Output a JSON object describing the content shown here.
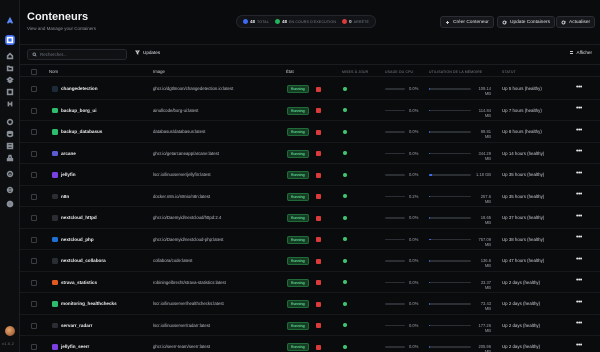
{
  "page": {
    "title": "Conteneurs",
    "subtitle": "View and Manage your Containers"
  },
  "sidebar": {
    "icons": [
      "arcane-logo-icon",
      "containers-icon",
      "home-icon",
      "folder-icon",
      "layers-icon",
      "image-icon",
      "network-icon",
      "volume-icon",
      "globe-icon",
      "database-icon",
      "server-icon",
      "drive-icon",
      "info-icon",
      "settings-icon",
      "user-icon"
    ],
    "version": "v1.0.2"
  },
  "stats": [
    {
      "num": "48",
      "label": "TOTAL",
      "color": "#3d6cf0"
    },
    {
      "num": "48",
      "label": "EN COURS D'EXECUTION",
      "color": "#22b45a"
    },
    {
      "num": "0",
      "label": "ARRÊTÉ",
      "color": "#d93a3a"
    }
  ],
  "actions": {
    "create": "Créer Conteneur",
    "update": "Update Containers",
    "refresh": "Actualiser"
  },
  "toolbar": {
    "search_placeholder": "Rechercher...",
    "filter": "Updates",
    "show": "Afficher"
  },
  "columns": {
    "name": "Nom",
    "image": "Image",
    "state": "État",
    "updates": "MISES À JOUR",
    "cpu": "USAGE DU CPU",
    "memory": "UTILISATION DE LA MÉMOIRE",
    "status": "STATUT"
  },
  "rows": [
    {
      "name": "changedetection",
      "image": "ghcr.io/dgtlmoon/changedetection.io:latest",
      "state": "Running",
      "cpu": "0.0%",
      "mem": "109.14 MB",
      "mem_frac": 0.01,
      "status": "Up 5 hours (healthy)",
      "icon_color": "#1c2a3a"
    },
    {
      "name": "backup_borg_ui",
      "image": "ainullcode/borg-ui:latest",
      "state": "Running",
      "cpu": "0.0%",
      "mem": "114.84 MB",
      "mem_frac": 0.01,
      "status": "Up 7 hours (healthy)",
      "icon_color": "#2dbd6e"
    },
    {
      "name": "backup_databasus",
      "image": "databasus/databasus:latest",
      "state": "Running",
      "cpu": "0.0%",
      "mem": "99.81 MB",
      "mem_frac": 0.01,
      "status": "Up 8 hours (healthy)",
      "icon_color": "#2dbd6e"
    },
    {
      "name": "arcane",
      "image": "ghcr.io/getarcaneapp/arcane:latest",
      "state": "Running",
      "cpu": "0.0%",
      "mem": "344.29 MB",
      "mem_frac": 0.02,
      "status": "Up 14 hours (healthy)",
      "icon_color": "#5b5bd6"
    },
    {
      "name": "jellyfin",
      "image": "lscr.io/linuxserver/jellyfin:latest",
      "state": "Running",
      "cpu": "0.0%",
      "mem": "1.18 GB",
      "mem_frac": 0.08,
      "status": "Up 35 hours (healthy)",
      "icon_color": "#7b3fe4"
    },
    {
      "name": "n8n",
      "image": "docker.n8n.io/n8nio/n8n:latest",
      "state": "Running",
      "cpu": "0.2%",
      "mem": "257.6 MB",
      "mem_frac": 0.02,
      "status": "Up 35 hours (healthy)",
      "icon_color": "#2a2d33"
    },
    {
      "name": "nextcloud_httpd",
      "image": "ghcr.io/Daemyid/nextcloud/httpd:2.4",
      "state": "Running",
      "cpu": "0.0%",
      "mem": "18.65 MB",
      "mem_frac": 0.005,
      "status": "Up 37 hours (healthy)",
      "icon_color": "#2a2d33"
    },
    {
      "name": "nextcloud_php",
      "image": "ghcr.io/Daemyid/nextcloud-php:latest",
      "state": "Running",
      "cpu": "0.0%",
      "mem": "757.09 MB",
      "mem_frac": 0.05,
      "status": "Up 38 hours (healthy)",
      "icon_color": "#1f6fd6"
    },
    {
      "name": "nextcloud_collabora",
      "image": "collabora/code:latest",
      "state": "Running",
      "cpu": "0.0%",
      "mem": "136.6 MB",
      "mem_frac": 0.01,
      "status": "Up 47 hours (healthy)",
      "icon_color": "#2a2d33"
    },
    {
      "name": "strava_statistics",
      "image": "robiningelbrecht/strava-statistics:latest",
      "state": "Running",
      "cpu": "0.0%",
      "mem": "33.37 MB",
      "mem_frac": 0.005,
      "status": "Up 2 days (healthy)",
      "icon_color": "#e3591f"
    },
    {
      "name": "monitoring_healthchecks",
      "image": "lscr.io/linuxserver/healthchecks:latest",
      "state": "Running",
      "cpu": "0.0%",
      "mem": "73.43 MB",
      "mem_frac": 0.005,
      "status": "Up 2 days (healthy)",
      "icon_color": "#2dbd6e"
    },
    {
      "name": "servarr_radarr",
      "image": "lscr.io/linuxserver/radarr:latest",
      "state": "Running",
      "cpu": "0.0%",
      "mem": "177.26 MB",
      "mem_frac": 0.01,
      "status": "Up 2 days (healthy)",
      "icon_color": "#2a2d33"
    },
    {
      "name": "jellyfin_seerr",
      "image": "ghcr.io/seerr-team/seerr:latest",
      "state": "Running",
      "cpu": "0.0%",
      "mem": "205.96 MB",
      "mem_frac": 0.01,
      "status": "Up 2 days (healthy)",
      "icon_color": "#7b3fe4"
    }
  ]
}
